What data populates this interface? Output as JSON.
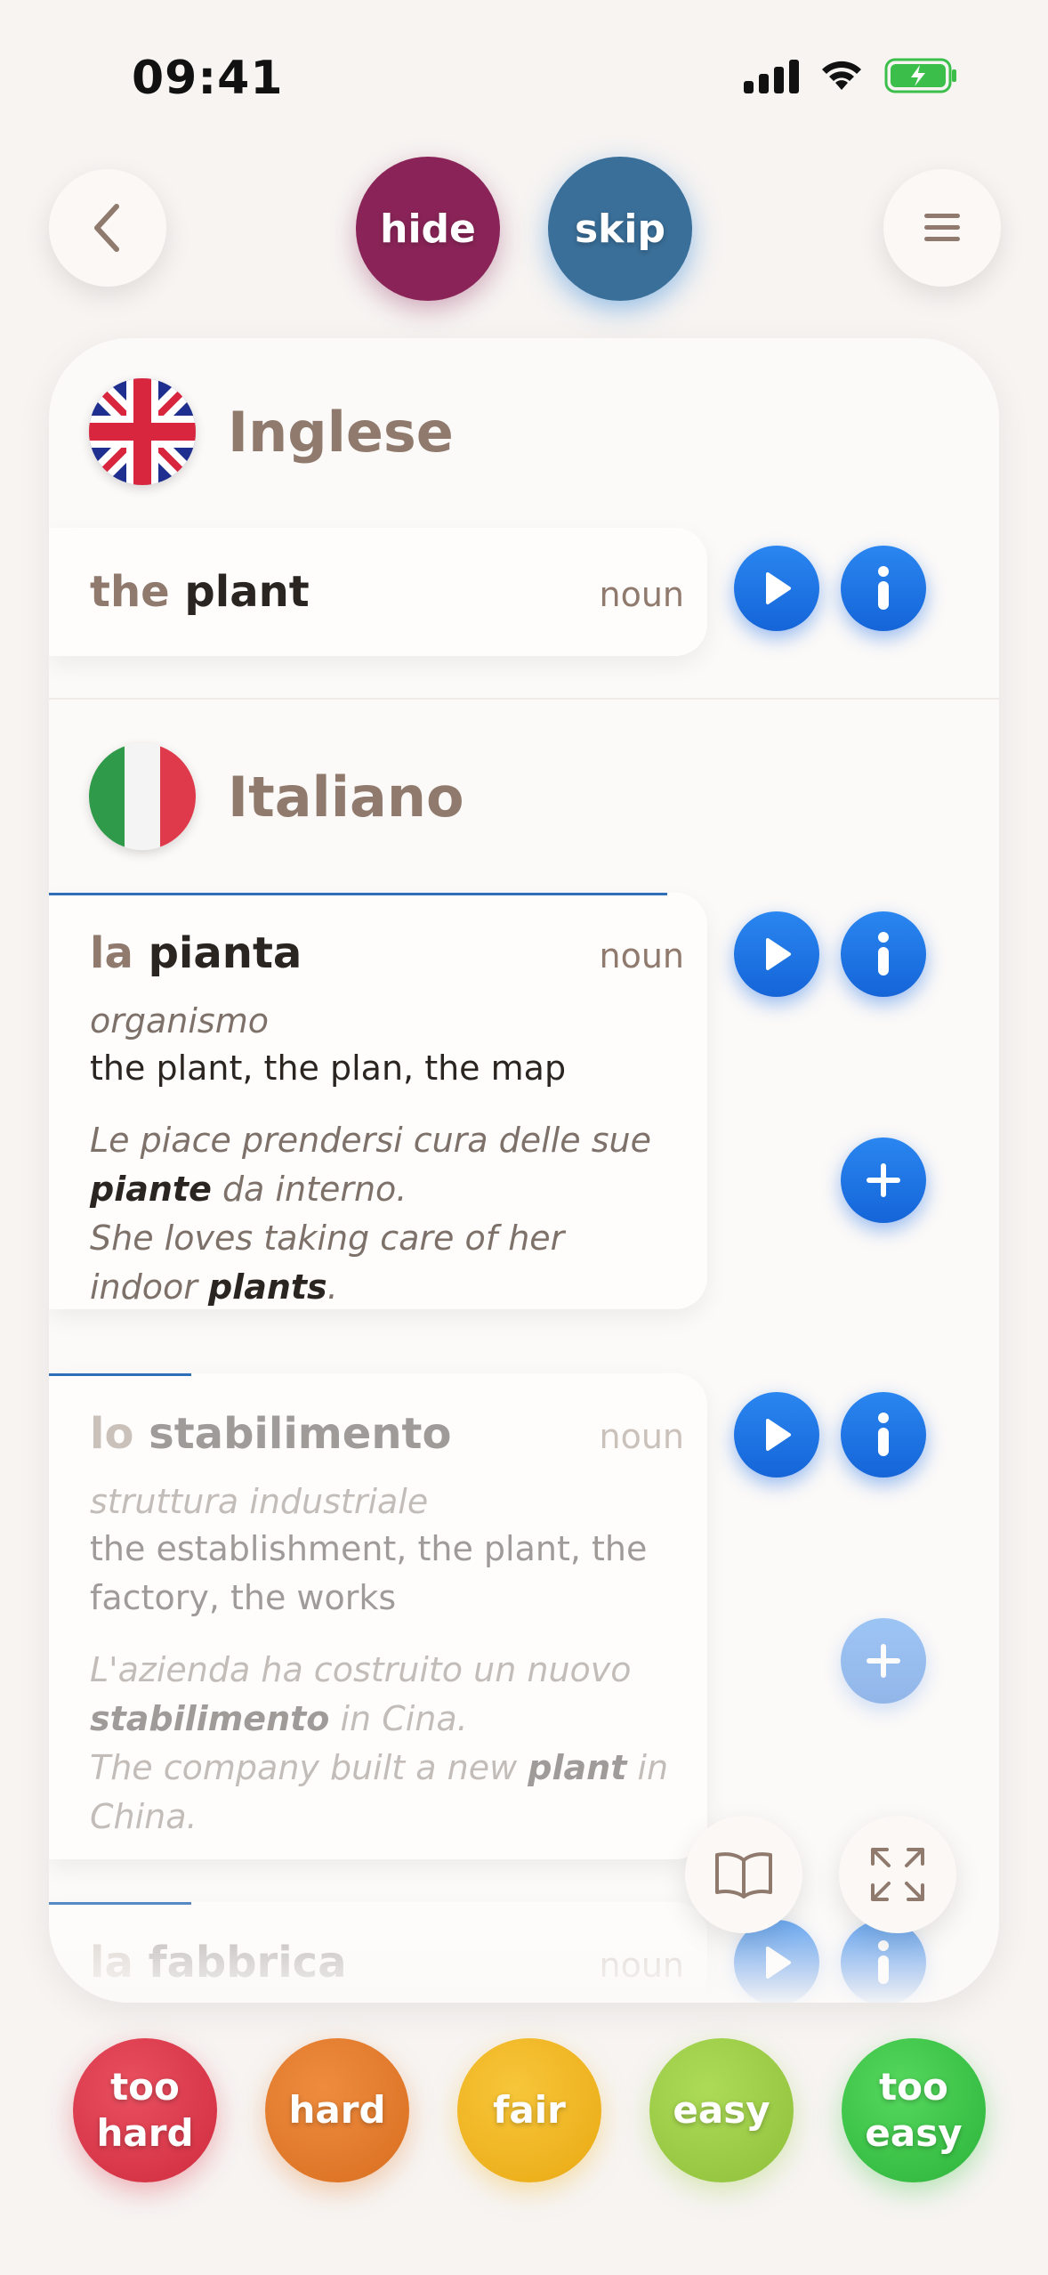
{
  "status_bar": {
    "time": "09:41"
  },
  "top_bar": {
    "hide_label": "hide",
    "skip_label": "skip"
  },
  "source": {
    "language": "Inglese",
    "entry": {
      "article": "the",
      "word": "plant",
      "pos": "noun"
    }
  },
  "target": {
    "language": "Italiano",
    "entries": [
      {
        "article": "la",
        "word": "pianta",
        "pos": "noun",
        "gloss": "organismo",
        "translation": "the plant, the plan, the map",
        "example_it_1": "Le piace prendersi cura delle sue",
        "example_it_bold": "piante",
        "example_it_2": " da interno.",
        "example_en_1": "She loves taking care of her",
        "example_en_2": "indoor ",
        "example_en_bold": "plants",
        "example_en_3": "."
      },
      {
        "article": "lo",
        "word": "stabilimento",
        "pos": "noun",
        "gloss": "struttura industriale",
        "translation": "the establishment, the plant, the factory, the works",
        "example_it_1": "L'azienda ha costruito un nuovo",
        "example_it_bold": "stabilimento",
        "example_it_2": " in Cina.",
        "example_en_1": "The company built a new ",
        "example_en_bold": "plant",
        "example_en_2": " in China."
      },
      {
        "article": "la",
        "word": "fabbrica",
        "pos": "noun"
      }
    ]
  },
  "rating": {
    "too_hard": "too hard",
    "hard": "hard",
    "fair": "fair",
    "easy": "easy",
    "too_easy": "too easy"
  },
  "colors": {
    "hide": "#8a2458",
    "skip": "#3a6f99",
    "accent_blue": "#1e73e6",
    "too_hard": "#d9364a",
    "hard": "#e27a2b",
    "fair": "#efb21c",
    "easy": "#9ccb45",
    "too_easy": "#3bc346"
  }
}
